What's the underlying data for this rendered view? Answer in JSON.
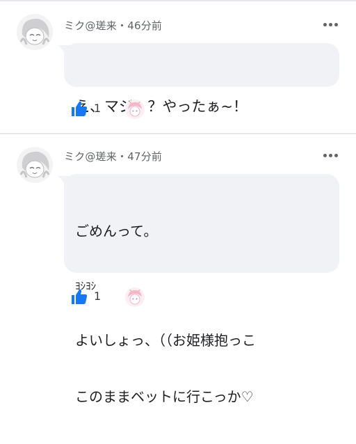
{
  "comments": [
    {
      "author": "ミク@瑳来",
      "separator": "・",
      "time": "46分前",
      "text_lines": [
        "え、マジ、？やったぁ~！"
      ],
      "like_count": "1",
      "icons": {
        "like": "thumbs-up-icon",
        "more": "more-options-icon"
      }
    },
    {
      "author": "ミク@瑳来",
      "separator": "・",
      "time": "47分前",
      "text_lines": [
        "ごめんって。",
        "ﾖｼﾖｼ",
        "よいしょっ、（（お姫様抱っこ",
        "このままベットに行こっか♡"
      ],
      "like_count": "1",
      "icons": {
        "like": "thumbs-up-icon",
        "more": "more-options-icon"
      }
    }
  ],
  "colors": {
    "bubble": "#f0f2f5",
    "like_blue": "#1877f2",
    "meta_text": "#5f6368",
    "body_text": "#1c1e21"
  }
}
